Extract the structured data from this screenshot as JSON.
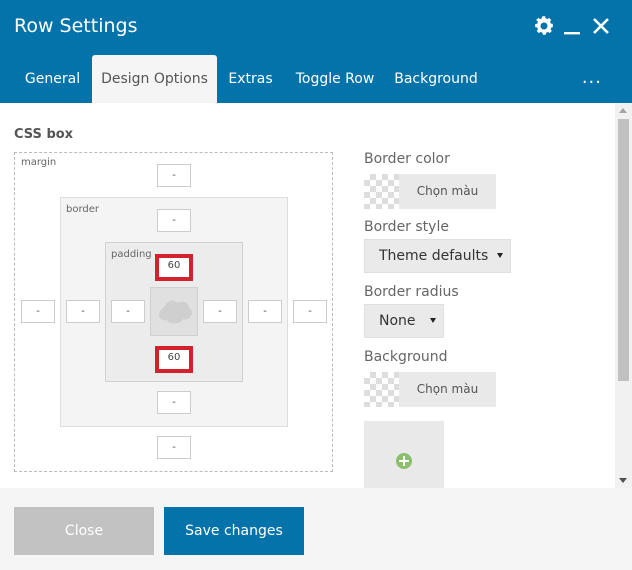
{
  "window": {
    "title": "Row Settings"
  },
  "header_icons": [
    "gear-icon",
    "minimize-icon",
    "close-icon"
  ],
  "tabs": [
    {
      "label": "General"
    },
    {
      "label": "Design Options"
    },
    {
      "label": "Extras"
    },
    {
      "label": "Toggle Row"
    },
    {
      "label": "Background"
    }
  ],
  "active_tab": "Design Options",
  "tabs_more": "...",
  "css_box": {
    "section_label": "CSS box",
    "margin_label": "margin",
    "border_label": "border",
    "padding_label": "padding",
    "margin": {
      "top": "-",
      "right": "-",
      "bottom": "-",
      "left": "-"
    },
    "border": {
      "top": "-",
      "right": "-",
      "bottom": "-",
      "left": "-"
    },
    "padding": {
      "top": "60",
      "right": "-",
      "bottom": "60",
      "left": "-"
    }
  },
  "options": {
    "border_color_label": "Border color",
    "border_color_button": "Chọn màu",
    "border_style_label": "Border style",
    "border_style_value": "Theme defaults",
    "border_radius_label": "Border radius",
    "border_radius_value": "None",
    "background_label": "Background",
    "background_color_button": "Chọn màu"
  },
  "footer": {
    "close_label": "Close",
    "save_label": "Save changes"
  },
  "colors": {
    "accent": "#0473aa",
    "highlight": "#d3212d",
    "close_button": "#c2c2c2"
  }
}
